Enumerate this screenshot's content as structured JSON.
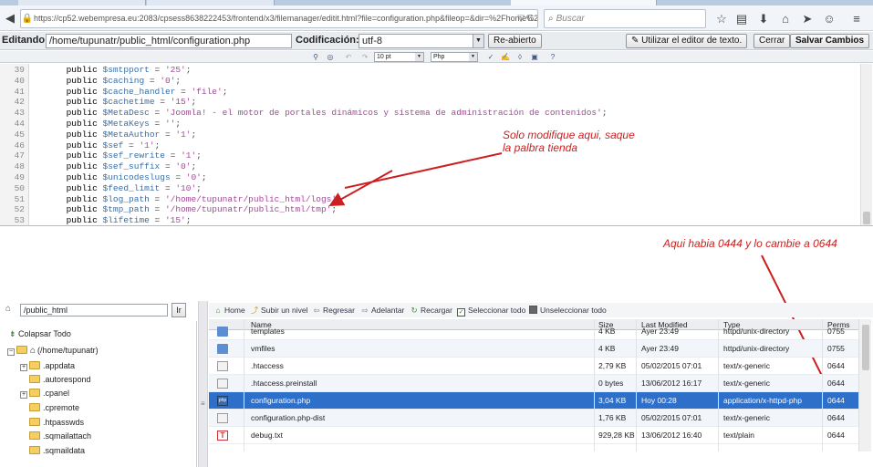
{
  "browser": {
    "url": "https://cp52.webempresa.eu:2083/cpsess8638222453/frontend/x3/filemanager/editit.html?file=configuration.php&fileop=&dir=%2Fhome%2I",
    "url_controls": "▽ C",
    "search_placeholder": "Buscar"
  },
  "editor_header": {
    "editing_label": "Editando:",
    "file_path": "/home/tupunatr/public_html/configuration.php",
    "encoding_label": "Codificación:",
    "encoding_value": "utf-8",
    "reopen_button": "Re-abierto",
    "text_editor_button": "Utilizar el editor de texto.",
    "close_button": "Cerrar",
    "save_button": "Salvar Cambios"
  },
  "editor_toolbar": {
    "font_size": "10 pt",
    "syntax": "Php"
  },
  "code_lines": [
    {
      "n": "39",
      "var": "$smtpport",
      "val": "'25'"
    },
    {
      "n": "40",
      "var": "$caching",
      "val": "'0'"
    },
    {
      "n": "41",
      "var": "$cache_handler",
      "val": "'file'"
    },
    {
      "n": "42",
      "var": "$cachetime",
      "val": "'15'"
    },
    {
      "n": "43",
      "var": "$MetaDesc",
      "val": "'Joomla! - el motor de portales dinámicos y sistema de administración de contenidos'"
    },
    {
      "n": "44",
      "var": "$MetaKeys",
      "val": "''"
    },
    {
      "n": "45",
      "var": "$MetaAuthor",
      "val": "'1'"
    },
    {
      "n": "46",
      "var": "$sef",
      "val": "'1'"
    },
    {
      "n": "47",
      "var": "$sef_rewrite",
      "val": "'1'"
    },
    {
      "n": "48",
      "var": "$sef_suffix",
      "val": "'0'"
    },
    {
      "n": "49",
      "var": "$unicodeslugs",
      "val": "'0'"
    },
    {
      "n": "50",
      "var": "$feed_limit",
      "val": "'10'"
    },
    {
      "n": "51",
      "var": "$log_path",
      "val": "'/home/tupunatr/public_html/logs'"
    },
    {
      "n": "52",
      "var": "$tmp_path",
      "val": "'/home/tupunatr/public_html/tmp'"
    },
    {
      "n": "53",
      "var": "$lifetime",
      "val": "'15'"
    }
  ],
  "code_keyword": "public",
  "annotations": {
    "note1_line1": "Solo modifique aqui, saque",
    "note1_line2": "la palbra tienda",
    "note2": "Aqui habia 0444 y lo cambie a 0644",
    "color": "#cc1f1f"
  },
  "file_manager": {
    "path_value": "/public_html",
    "go_button": "Ir",
    "collapse_all": "Colapsar Todo",
    "tree_root": "(/home/tupunatr)",
    "tree_items": [
      ".appdata",
      ".autorespond",
      ".cpanel",
      ".cpremote",
      ".htpasswds",
      ".sqmailattach",
      ".sqmaildata"
    ],
    "toolbar": {
      "home": "Home",
      "up": "Subir un nivel",
      "back": "Regresar",
      "forward": "Adelantar",
      "reload": "Recargar",
      "select_all": "Seleccionar todo",
      "deselect_all": "Unseleccionar todo"
    },
    "columns": {
      "name": "Name",
      "size": "Size",
      "modified": "Last Modified",
      "type": "Type",
      "perms": "Perms"
    },
    "rows": [
      {
        "name": "templates",
        "size": "4 KB",
        "modified": "Ayer 23:49",
        "type": "httpd/unix-directory",
        "perms": "0755",
        "icon": "folder"
      },
      {
        "name": "vmfiles",
        "size": "4 KB",
        "modified": "Ayer 23:49",
        "type": "httpd/unix-directory",
        "perms": "0755",
        "icon": "folder"
      },
      {
        "name": ".htaccess",
        "size": "2,79 KB",
        "modified": "05/02/2015 07:01",
        "type": "text/x-generic",
        "perms": "0644",
        "icon": "file"
      },
      {
        "name": ".htaccess.preinstall",
        "size": "0 bytes",
        "modified": "13/06/2012 16:17",
        "type": "text/x-generic",
        "perms": "0644",
        "icon": "file"
      },
      {
        "name": "configuration.php",
        "size": "3,04 KB",
        "modified": "Hoy 00:28",
        "type": "application/x-httpd-php",
        "perms": "0644",
        "icon": "php",
        "selected": true
      },
      {
        "name": "configuration.php-dist",
        "size": "1,76 KB",
        "modified": "05/02/2015 07:01",
        "type": "text/x-generic",
        "perms": "0644",
        "icon": "file"
      },
      {
        "name": "debug.txt",
        "size": "929,28 KB",
        "modified": "13/06/2012 16:40",
        "type": "text/plain",
        "perms": "0644",
        "icon": "txt"
      }
    ]
  }
}
